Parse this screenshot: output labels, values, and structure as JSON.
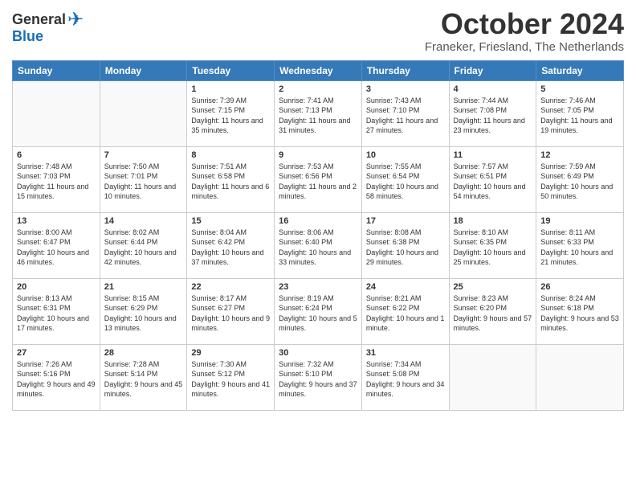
{
  "logo": {
    "general": "General",
    "blue": "Blue"
  },
  "header": {
    "month": "October 2024",
    "location": "Franeker, Friesland, The Netherlands"
  },
  "weekdays": [
    "Sunday",
    "Monday",
    "Tuesday",
    "Wednesday",
    "Thursday",
    "Friday",
    "Saturday"
  ],
  "weeks": [
    [
      {
        "day": "",
        "sunrise": "",
        "sunset": "",
        "daylight": ""
      },
      {
        "day": "",
        "sunrise": "",
        "sunset": "",
        "daylight": ""
      },
      {
        "day": "1",
        "sunrise": "Sunrise: 7:39 AM",
        "sunset": "Sunset: 7:15 PM",
        "daylight": "Daylight: 11 hours and 35 minutes."
      },
      {
        "day": "2",
        "sunrise": "Sunrise: 7:41 AM",
        "sunset": "Sunset: 7:13 PM",
        "daylight": "Daylight: 11 hours and 31 minutes."
      },
      {
        "day": "3",
        "sunrise": "Sunrise: 7:43 AM",
        "sunset": "Sunset: 7:10 PM",
        "daylight": "Daylight: 11 hours and 27 minutes."
      },
      {
        "day": "4",
        "sunrise": "Sunrise: 7:44 AM",
        "sunset": "Sunset: 7:08 PM",
        "daylight": "Daylight: 11 hours and 23 minutes."
      },
      {
        "day": "5",
        "sunrise": "Sunrise: 7:46 AM",
        "sunset": "Sunset: 7:05 PM",
        "daylight": "Daylight: 11 hours and 19 minutes."
      }
    ],
    [
      {
        "day": "6",
        "sunrise": "Sunrise: 7:48 AM",
        "sunset": "Sunset: 7:03 PM",
        "daylight": "Daylight: 11 hours and 15 minutes."
      },
      {
        "day": "7",
        "sunrise": "Sunrise: 7:50 AM",
        "sunset": "Sunset: 7:01 PM",
        "daylight": "Daylight: 11 hours and 10 minutes."
      },
      {
        "day": "8",
        "sunrise": "Sunrise: 7:51 AM",
        "sunset": "Sunset: 6:58 PM",
        "daylight": "Daylight: 11 hours and 6 minutes."
      },
      {
        "day": "9",
        "sunrise": "Sunrise: 7:53 AM",
        "sunset": "Sunset: 6:56 PM",
        "daylight": "Daylight: 11 hours and 2 minutes."
      },
      {
        "day": "10",
        "sunrise": "Sunrise: 7:55 AM",
        "sunset": "Sunset: 6:54 PM",
        "daylight": "Daylight: 10 hours and 58 minutes."
      },
      {
        "day": "11",
        "sunrise": "Sunrise: 7:57 AM",
        "sunset": "Sunset: 6:51 PM",
        "daylight": "Daylight: 10 hours and 54 minutes."
      },
      {
        "day": "12",
        "sunrise": "Sunrise: 7:59 AM",
        "sunset": "Sunset: 6:49 PM",
        "daylight": "Daylight: 10 hours and 50 minutes."
      }
    ],
    [
      {
        "day": "13",
        "sunrise": "Sunrise: 8:00 AM",
        "sunset": "Sunset: 6:47 PM",
        "daylight": "Daylight: 10 hours and 46 minutes."
      },
      {
        "day": "14",
        "sunrise": "Sunrise: 8:02 AM",
        "sunset": "Sunset: 6:44 PM",
        "daylight": "Daylight: 10 hours and 42 minutes."
      },
      {
        "day": "15",
        "sunrise": "Sunrise: 8:04 AM",
        "sunset": "Sunset: 6:42 PM",
        "daylight": "Daylight: 10 hours and 37 minutes."
      },
      {
        "day": "16",
        "sunrise": "Sunrise: 8:06 AM",
        "sunset": "Sunset: 6:40 PM",
        "daylight": "Daylight: 10 hours and 33 minutes."
      },
      {
        "day": "17",
        "sunrise": "Sunrise: 8:08 AM",
        "sunset": "Sunset: 6:38 PM",
        "daylight": "Daylight: 10 hours and 29 minutes."
      },
      {
        "day": "18",
        "sunrise": "Sunrise: 8:10 AM",
        "sunset": "Sunset: 6:35 PM",
        "daylight": "Daylight: 10 hours and 25 minutes."
      },
      {
        "day": "19",
        "sunrise": "Sunrise: 8:11 AM",
        "sunset": "Sunset: 6:33 PM",
        "daylight": "Daylight: 10 hours and 21 minutes."
      }
    ],
    [
      {
        "day": "20",
        "sunrise": "Sunrise: 8:13 AM",
        "sunset": "Sunset: 6:31 PM",
        "daylight": "Daylight: 10 hours and 17 minutes."
      },
      {
        "day": "21",
        "sunrise": "Sunrise: 8:15 AM",
        "sunset": "Sunset: 6:29 PM",
        "daylight": "Daylight: 10 hours and 13 minutes."
      },
      {
        "day": "22",
        "sunrise": "Sunrise: 8:17 AM",
        "sunset": "Sunset: 6:27 PM",
        "daylight": "Daylight: 10 hours and 9 minutes."
      },
      {
        "day": "23",
        "sunrise": "Sunrise: 8:19 AM",
        "sunset": "Sunset: 6:24 PM",
        "daylight": "Daylight: 10 hours and 5 minutes."
      },
      {
        "day": "24",
        "sunrise": "Sunrise: 8:21 AM",
        "sunset": "Sunset: 6:22 PM",
        "daylight": "Daylight: 10 hours and 1 minute."
      },
      {
        "day": "25",
        "sunrise": "Sunrise: 8:23 AM",
        "sunset": "Sunset: 6:20 PM",
        "daylight": "Daylight: 9 hours and 57 minutes."
      },
      {
        "day": "26",
        "sunrise": "Sunrise: 8:24 AM",
        "sunset": "Sunset: 6:18 PM",
        "daylight": "Daylight: 9 hours and 53 minutes."
      }
    ],
    [
      {
        "day": "27",
        "sunrise": "Sunrise: 7:26 AM",
        "sunset": "Sunset: 5:16 PM",
        "daylight": "Daylight: 9 hours and 49 minutes."
      },
      {
        "day": "28",
        "sunrise": "Sunrise: 7:28 AM",
        "sunset": "Sunset: 5:14 PM",
        "daylight": "Daylight: 9 hours and 45 minutes."
      },
      {
        "day": "29",
        "sunrise": "Sunrise: 7:30 AM",
        "sunset": "Sunset: 5:12 PM",
        "daylight": "Daylight: 9 hours and 41 minutes."
      },
      {
        "day": "30",
        "sunrise": "Sunrise: 7:32 AM",
        "sunset": "Sunset: 5:10 PM",
        "daylight": "Daylight: 9 hours and 37 minutes."
      },
      {
        "day": "31",
        "sunrise": "Sunrise: 7:34 AM",
        "sunset": "Sunset: 5:08 PM",
        "daylight": "Daylight: 9 hours and 34 minutes."
      },
      {
        "day": "",
        "sunrise": "",
        "sunset": "",
        "daylight": ""
      },
      {
        "day": "",
        "sunrise": "",
        "sunset": "",
        "daylight": ""
      }
    ]
  ]
}
